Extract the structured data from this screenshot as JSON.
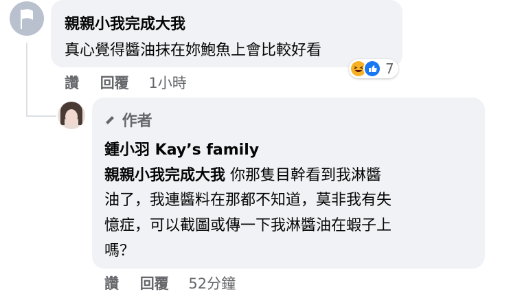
{
  "comment": {
    "author": "親親小我完成大我",
    "text": "真心覺得醬油抹在妳鮑魚上會比較好看",
    "reactions": {
      "icons": [
        "haha-icon",
        "like-icon"
      ],
      "count": "7",
      "haha_color": "#f7b125",
      "like_color": "#1877f2"
    },
    "actions": {
      "like": "讚",
      "reply": "回覆",
      "time": "1小時"
    }
  },
  "reply": {
    "badge": "作者",
    "author": "鍾小羽 Kay’s family",
    "mention": "親親小我完成大我",
    "lines": [
      " 你那隻目幹看到我淋醬",
      "油了，我連醬料在那都不知道，莫非我有失",
      "憶症，可以截圖或傳一下我淋醬油在蝦子上",
      "嗎？"
    ],
    "actions": {
      "like": "讚",
      "reply": "回覆",
      "time": "52分鐘"
    }
  }
}
